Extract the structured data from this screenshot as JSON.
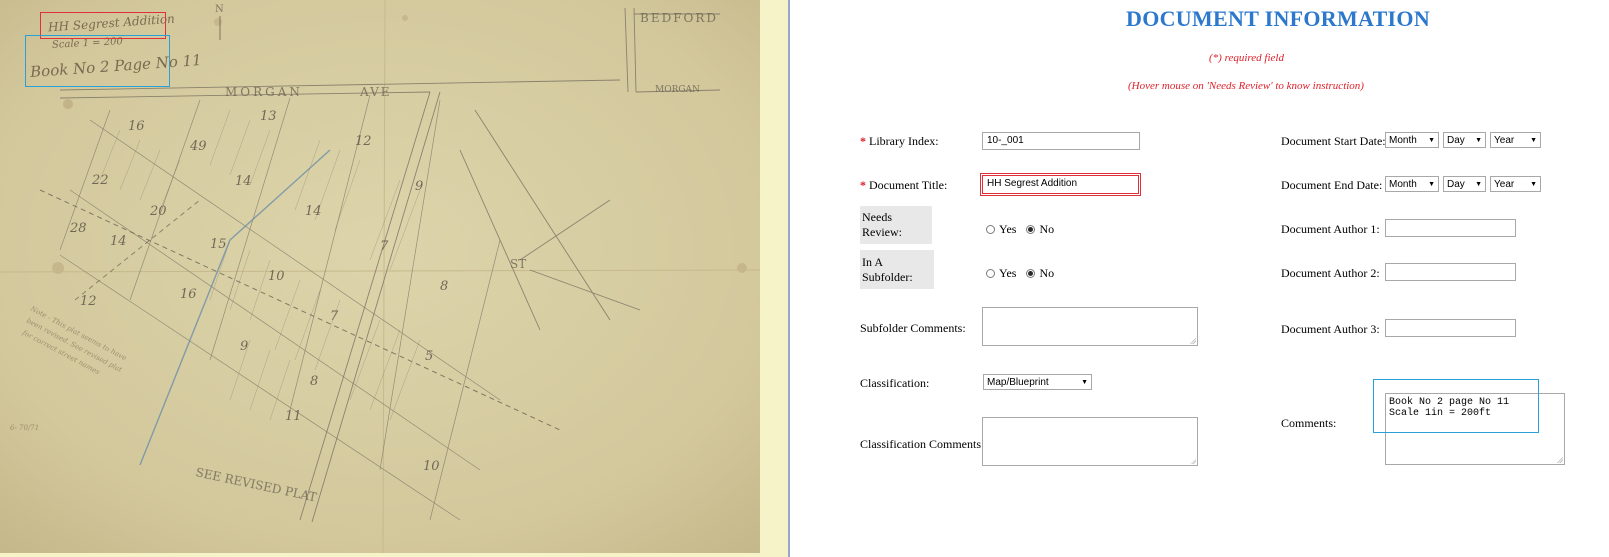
{
  "map_annotations": {
    "title": "HH Segrest Addition",
    "scale": "Scale 1 = 200",
    "book": "Book No 2 Page No 11"
  },
  "form": {
    "heading": "DOCUMENT INFORMATION",
    "required_note": "(*) required field",
    "hover_note": "(Hover mouse on 'Needs Review' to know instruction)",
    "required_mark": "*",
    "library_index": {
      "label": "Library Index:",
      "value": "10-_001"
    },
    "document_title": {
      "label": "Document Title:",
      "value": "HH Segrest Addition"
    },
    "needs_review": {
      "label": "Needs Review:",
      "yes": "Yes",
      "no": "No",
      "selected": "No"
    },
    "in_subfolder": {
      "label": "In A Subfolder:",
      "yes": "Yes",
      "no": "No",
      "selected": "No"
    },
    "subfolder_comments": {
      "label": "Subfolder Comments:",
      "value": ""
    },
    "classification": {
      "label": "Classification:",
      "value": "Map/Blueprint"
    },
    "classification_comments": {
      "label": "Classification Comments:",
      "value": ""
    },
    "start_date": {
      "label": "Document Start Date:",
      "month": "Month",
      "day": "Day",
      "year": "Year"
    },
    "end_date": {
      "label": "Document End Date:",
      "month": "Month",
      "day": "Day",
      "year": "Year"
    },
    "author1": {
      "label": "Document Author 1:",
      "value": ""
    },
    "author2": {
      "label": "Document Author 2:",
      "value": ""
    },
    "author3": {
      "label": "Document Author 3:",
      "value": ""
    },
    "comments": {
      "label": "Comments:",
      "line1": "Book No 2 page No 11",
      "line2": "Scale 1in = 200ft"
    }
  },
  "colors": {
    "heading": "#2b78cc",
    "required": "#e0202a",
    "highlight_red": "#e0303a",
    "highlight_blue": "#28a0d8",
    "paper": "#d8cfa4"
  }
}
